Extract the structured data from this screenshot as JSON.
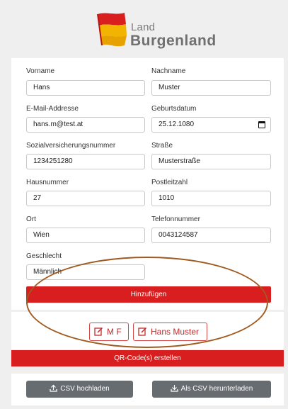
{
  "logo": {
    "line1": "Land",
    "line2": "Burgenland"
  },
  "form": {
    "vorname": {
      "label": "Vorname",
      "value": "Hans"
    },
    "nachname": {
      "label": "Nachname",
      "value": "Muster"
    },
    "email": {
      "label": "E-Mail-Addresse",
      "value": "hans.m@test.at"
    },
    "geburtsdatum": {
      "label": "Geburtsdatum",
      "value": "25.12.1080"
    },
    "svnr": {
      "label": "Sozialversicherungsnummer",
      "value": "1234251280"
    },
    "strasse": {
      "label": "Straße",
      "value": "Musterstraße"
    },
    "hausnummer": {
      "label": "Hausnummer",
      "value": "27"
    },
    "plz": {
      "label": "Postleitzahl",
      "value": "1010"
    },
    "ort": {
      "label": "Ort",
      "value": "Wien"
    },
    "telefon": {
      "label": "Telefonnummer",
      "value": "0043124587"
    },
    "geschlecht": {
      "label": "Geschlecht",
      "value": "Männlich"
    },
    "add_button": "Hinzufügen"
  },
  "entries": [
    {
      "label": "M F"
    },
    {
      "label": "Hans Muster"
    }
  ],
  "qr_button": "QR-Code(s) erstellen",
  "upload_button": "CSV hochladen",
  "download_button": "Als CSV herunterladen",
  "colors": {
    "accent_red": "#d81e1e",
    "button_gray": "#676c71",
    "annotation_brown": "#a05a1f"
  }
}
